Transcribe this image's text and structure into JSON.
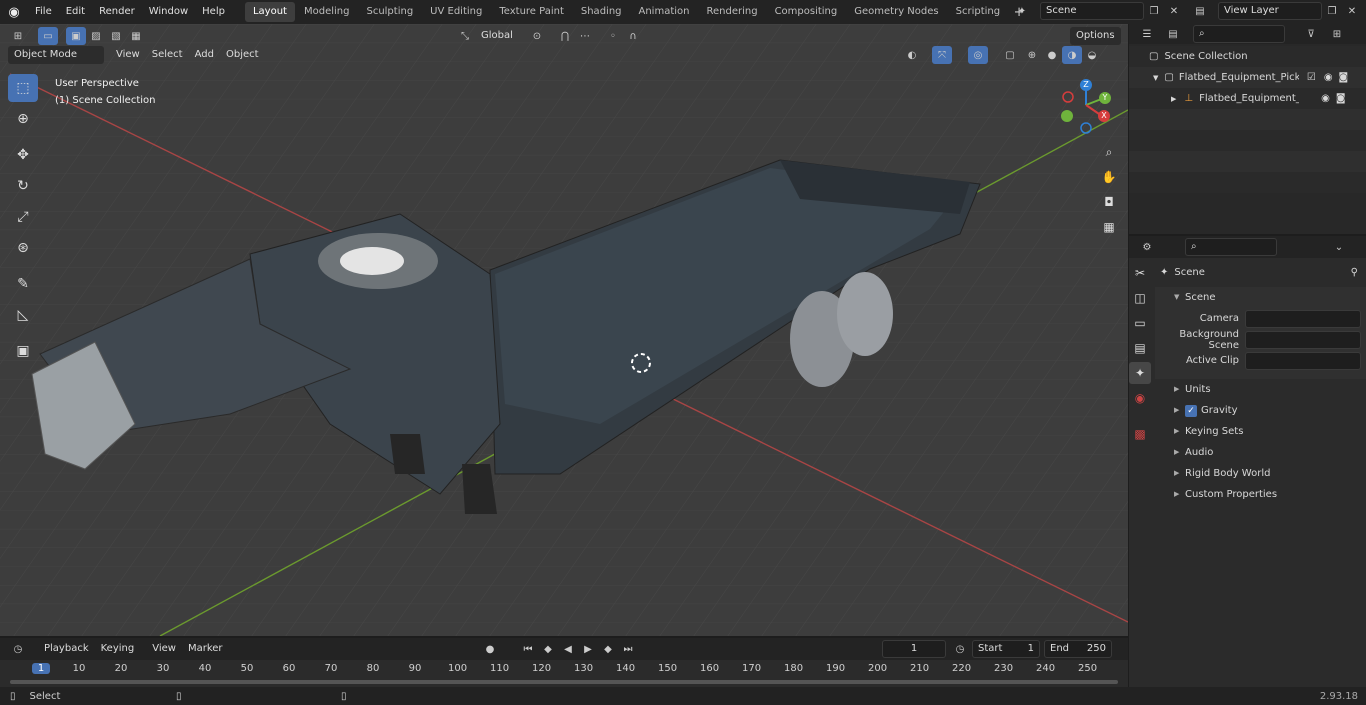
{
  "menu": [
    "File",
    "Edit",
    "Render",
    "Window",
    "Help"
  ],
  "workspaces": [
    "Layout",
    "Modeling",
    "Sculpting",
    "UV Editing",
    "Texture Paint",
    "Shading",
    "Animation",
    "Rendering",
    "Compositing",
    "Geometry Nodes",
    "Scripting"
  ],
  "scene_name": "Scene",
  "view_layer": "View Layer",
  "viewport": {
    "transform_orientation": "Global",
    "options_label": "Options",
    "mode": "Object Mode",
    "menu": [
      "View",
      "Select",
      "Add",
      "Object"
    ],
    "overlay_title": "User Perspective",
    "overlay_collection": "(1) Scene Collection",
    "gizmo_axes": [
      "Z",
      "Y",
      "X"
    ]
  },
  "outliner": {
    "search_placeholder": "",
    "root": "Scene Collection",
    "items": [
      "Flatbed_Equipment_Pickup_T",
      "Flatbed_Equipment_Picki"
    ]
  },
  "properties": {
    "context": "Scene",
    "section": "Scene",
    "fields": [
      {
        "label": "Camera",
        "value": ""
      },
      {
        "label": "Background Scene",
        "value": ""
      },
      {
        "label": "Active Clip",
        "value": ""
      }
    ],
    "panels": [
      "Units",
      "Gravity",
      "Keying Sets",
      "Audio",
      "Rigid Body World",
      "Custom Properties"
    ]
  },
  "timeline": {
    "menus": [
      "Playback",
      "Keying",
      "View",
      "Marker"
    ],
    "current_frame": "1",
    "start_label": "Start",
    "start": "1",
    "end_label": "End",
    "end": "250",
    "ruler": [
      "1",
      "10",
      "20",
      "30",
      "40",
      "50",
      "60",
      "70",
      "80",
      "90",
      "100",
      "110",
      "120",
      "130",
      "140",
      "150",
      "160",
      "170",
      "180",
      "190",
      "200",
      "210",
      "220",
      "230",
      "240",
      "250"
    ]
  },
  "status": {
    "left": "Select",
    "version": "2.93.18"
  },
  "colors": {
    "accent": "#4772b3",
    "x_axis": "#d63d3d",
    "y_axis": "#6fb33c",
    "z_axis": "#2f80d6",
    "floor_line_x": "#b54747",
    "floor_line_y": "#6f9a30"
  }
}
